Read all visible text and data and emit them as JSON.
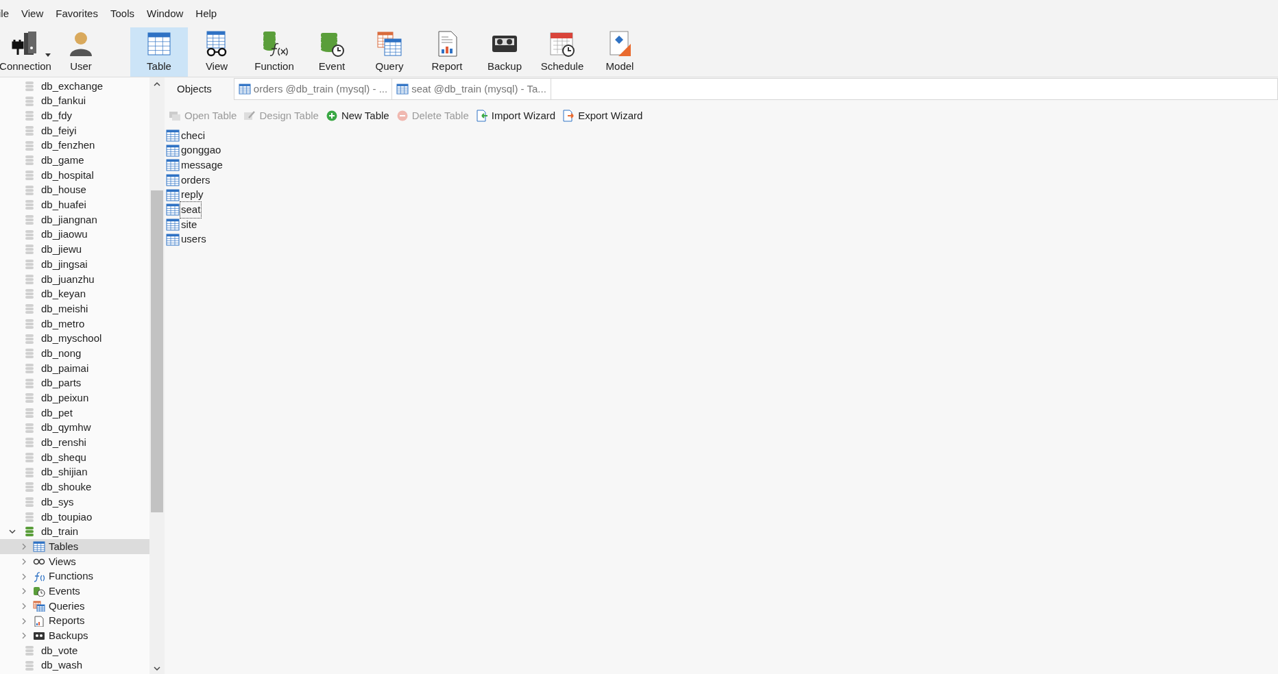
{
  "menu": [
    "ile",
    "View",
    "Favorites",
    "Tools",
    "Window",
    "Help"
  ],
  "toolbar": [
    {
      "kind": "connection",
      "label": "Connection",
      "selected": false,
      "dropdown": true
    },
    {
      "kind": "user",
      "label": "User",
      "selected": false
    },
    {
      "kind": "table",
      "label": "Table",
      "selected": true
    },
    {
      "kind": "view",
      "label": "View",
      "selected": false
    },
    {
      "kind": "function",
      "label": "Function",
      "selected": false
    },
    {
      "kind": "event",
      "label": "Event",
      "selected": false
    },
    {
      "kind": "query",
      "label": "Query",
      "selected": false
    },
    {
      "kind": "report",
      "label": "Report",
      "selected": false
    },
    {
      "kind": "backup",
      "label": "Backup",
      "selected": false
    },
    {
      "kind": "schedule",
      "label": "Schedule",
      "selected": false
    },
    {
      "kind": "model",
      "label": "Model",
      "selected": false
    }
  ],
  "sidebar": {
    "items": [
      {
        "kind": "database",
        "label": "db_exchange",
        "open": false,
        "selected": false
      },
      {
        "kind": "database",
        "label": "db_fankui",
        "open": false,
        "selected": false
      },
      {
        "kind": "database",
        "label": "db_fdy",
        "open": false,
        "selected": false
      },
      {
        "kind": "database",
        "label": "db_feiyi",
        "open": false,
        "selected": false
      },
      {
        "kind": "database",
        "label": "db_fenzhen",
        "open": false,
        "selected": false
      },
      {
        "kind": "database",
        "label": "db_game",
        "open": false,
        "selected": false
      },
      {
        "kind": "database",
        "label": "db_hospital",
        "open": false,
        "selected": false
      },
      {
        "kind": "database",
        "label": "db_house",
        "open": false,
        "selected": false
      },
      {
        "kind": "database",
        "label": "db_huafei",
        "open": false,
        "selected": false
      },
      {
        "kind": "database",
        "label": "db_jiangnan",
        "open": false,
        "selected": false
      },
      {
        "kind": "database",
        "label": "db_jiaowu",
        "open": false,
        "selected": false
      },
      {
        "kind": "database",
        "label": "db_jiewu",
        "open": false,
        "selected": false
      },
      {
        "kind": "database",
        "label": "db_jingsai",
        "open": false,
        "selected": false
      },
      {
        "kind": "database",
        "label": "db_juanzhu",
        "open": false,
        "selected": false
      },
      {
        "kind": "database",
        "label": "db_keyan",
        "open": false,
        "selected": false
      },
      {
        "kind": "database",
        "label": "db_meishi",
        "open": false,
        "selected": false
      },
      {
        "kind": "database",
        "label": "db_metro",
        "open": false,
        "selected": false
      },
      {
        "kind": "database",
        "label": "db_myschool",
        "open": false,
        "selected": false
      },
      {
        "kind": "database",
        "label": "db_nong",
        "open": false,
        "selected": false
      },
      {
        "kind": "database",
        "label": "db_paimai",
        "open": false,
        "selected": false
      },
      {
        "kind": "database",
        "label": "db_parts",
        "open": false,
        "selected": false
      },
      {
        "kind": "database",
        "label": "db_peixun",
        "open": false,
        "selected": false
      },
      {
        "kind": "database",
        "label": "db_pet",
        "open": false,
        "selected": false
      },
      {
        "kind": "database",
        "label": "db_qymhw",
        "open": false,
        "selected": false
      },
      {
        "kind": "database",
        "label": "db_renshi",
        "open": false,
        "selected": false
      },
      {
        "kind": "database",
        "label": "db_shequ",
        "open": false,
        "selected": false
      },
      {
        "kind": "database",
        "label": "db_shijian",
        "open": false,
        "selected": false
      },
      {
        "kind": "database",
        "label": "db_shouke",
        "open": false,
        "selected": false
      },
      {
        "kind": "database",
        "label": "db_sys",
        "open": false,
        "selected": false
      },
      {
        "kind": "database",
        "label": "db_toupiao",
        "open": false,
        "selected": false
      },
      {
        "kind": "database",
        "label": "db_train",
        "open": true,
        "selected": false,
        "expanded": true,
        "children": [
          {
            "kind": "tables",
            "label": "Tables",
            "selected": true,
            "expanded": false
          },
          {
            "kind": "views",
            "label": "Views",
            "selected": false,
            "expanded": false
          },
          {
            "kind": "functions",
            "label": "Functions",
            "selected": false,
            "expanded": false
          },
          {
            "kind": "events",
            "label": "Events",
            "selected": false,
            "expanded": false
          },
          {
            "kind": "queries",
            "label": "Queries",
            "selected": false,
            "expanded": false
          },
          {
            "kind": "reports",
            "label": "Reports",
            "selected": false,
            "expanded": false
          },
          {
            "kind": "backups",
            "label": "Backups",
            "selected": false,
            "expanded": false
          }
        ]
      },
      {
        "kind": "database",
        "label": "db_vote",
        "open": false,
        "selected": false
      },
      {
        "kind": "database",
        "label": "db_wash",
        "open": false,
        "selected": false
      }
    ]
  },
  "tabs": [
    {
      "kind": "objects",
      "label": "Objects",
      "selected": true
    },
    {
      "kind": "table",
      "label": "orders @db_train (mysql) - ...",
      "selected": false
    },
    {
      "kind": "table",
      "label": "seat @db_train (mysql) - Ta...",
      "selected": false
    }
  ],
  "actions": [
    {
      "kind": "open",
      "label": "Open Table",
      "disabled": true
    },
    {
      "kind": "design",
      "label": "Design Table",
      "disabled": true
    },
    {
      "kind": "new",
      "label": "New Table",
      "disabled": false
    },
    {
      "kind": "delete",
      "label": "Delete Table",
      "disabled": true
    },
    {
      "kind": "import",
      "label": "Import Wizard",
      "disabled": false
    },
    {
      "kind": "export",
      "label": "Export Wizard",
      "disabled": false
    }
  ],
  "tables": [
    {
      "label": "checi",
      "selected": false
    },
    {
      "label": "gonggao",
      "selected": false
    },
    {
      "label": "message",
      "selected": false
    },
    {
      "label": "orders",
      "selected": false
    },
    {
      "label": "reply",
      "selected": false
    },
    {
      "label": "seat",
      "selected": true
    },
    {
      "label": "site",
      "selected": false
    },
    {
      "label": "users",
      "selected": false
    }
  ]
}
